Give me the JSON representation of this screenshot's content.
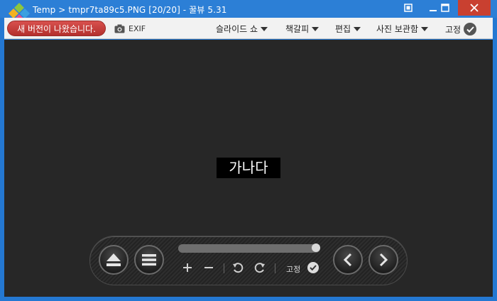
{
  "window": {
    "title": "Temp > tmpr7ta89c5.PNG  [20/20] - 꿀뷰 5.31"
  },
  "toolbar": {
    "update_label": "새 버전이 나왔습니다.",
    "exif_label": "EXIF",
    "menus": [
      {
        "label": "슬라이드 쇼"
      },
      {
        "label": "책갈피"
      },
      {
        "label": "편집"
      },
      {
        "label": "사진 보관함"
      }
    ],
    "fix_label": "고정"
  },
  "viewer": {
    "image_text": "가나다",
    "background": "#272727"
  },
  "controls": {
    "progress_fraction": 1.0,
    "fix_label": "고정"
  },
  "colors": {
    "titlebar": "#2c7fd6",
    "close_button": "#c94030",
    "update_button": "#c03a37"
  },
  "icons": {
    "app_logo": "honeyview-logo-icon",
    "camera": "camera-icon",
    "check": "check-icon",
    "eject": "eject-icon",
    "menu": "hamburger-menu-icon",
    "zoom_in": "plus-icon",
    "zoom_out": "minus-icon",
    "rotate_left": "rotate-left-icon",
    "rotate_right": "rotate-right-icon",
    "prev": "chevron-left-icon",
    "next": "chevron-right-icon"
  }
}
